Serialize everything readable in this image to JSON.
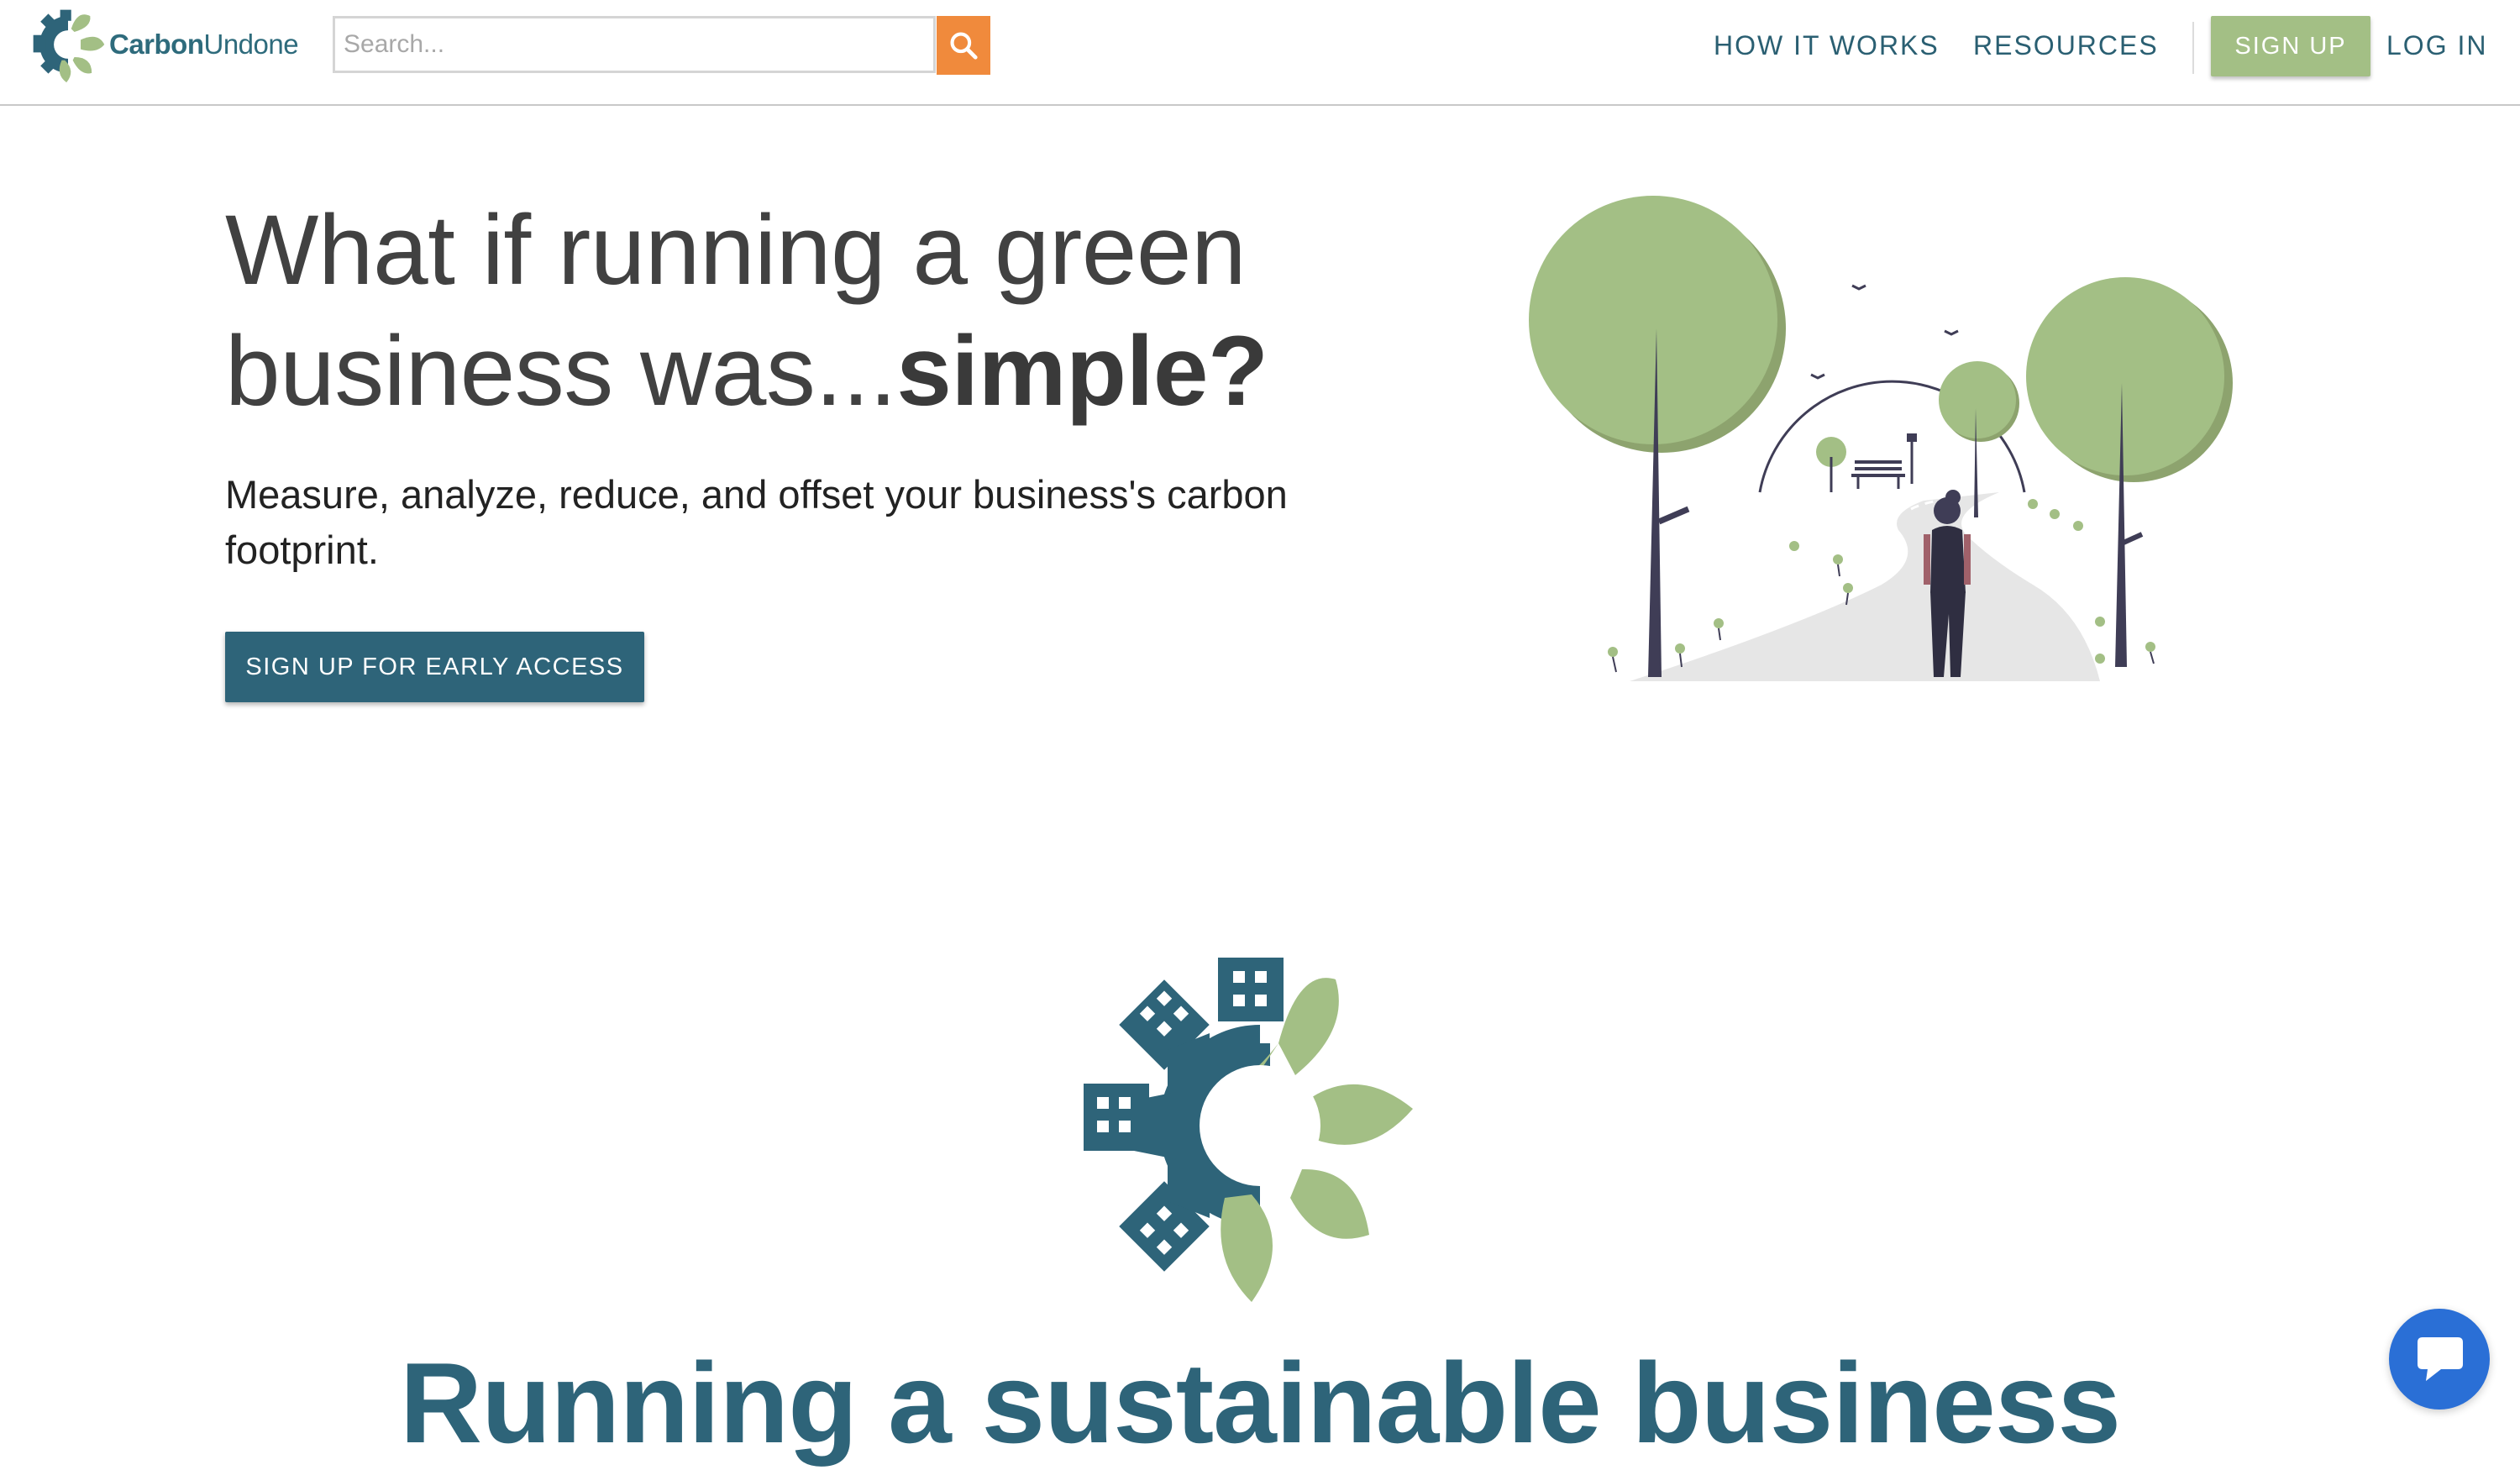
{
  "header": {
    "logo": {
      "brand_bold": "Carbon",
      "brand_light": "Undone",
      "icon": "carbonundone-logo-icon"
    },
    "search": {
      "placeholder": "Search...",
      "icon": "search-icon"
    },
    "nav": {
      "how_it_works": "HOW IT WORKS",
      "resources": "RESOURCES",
      "sign_up": "SIGN UP",
      "log_in": "LOG IN"
    }
  },
  "hero": {
    "title_part1": "What if running a green business was...",
    "title_emphasis": "simple?",
    "subtitle": "Measure, analyze, reduce, and offset your business's carbon footprint.",
    "cta_label": "SIGN UP FOR EARLY ACCESS",
    "illustration": "park-walk-illustration"
  },
  "section": {
    "emblem": "carbonundone-emblem-icon",
    "heading": "Running a sustainable business"
  },
  "chat": {
    "icon": "chat-bubble-icon"
  },
  "colors": {
    "brand_teal": "#2e6479",
    "brand_green": "#a3bf85",
    "search_orange": "#f08a3c",
    "chat_blue": "#2a6fd6"
  }
}
